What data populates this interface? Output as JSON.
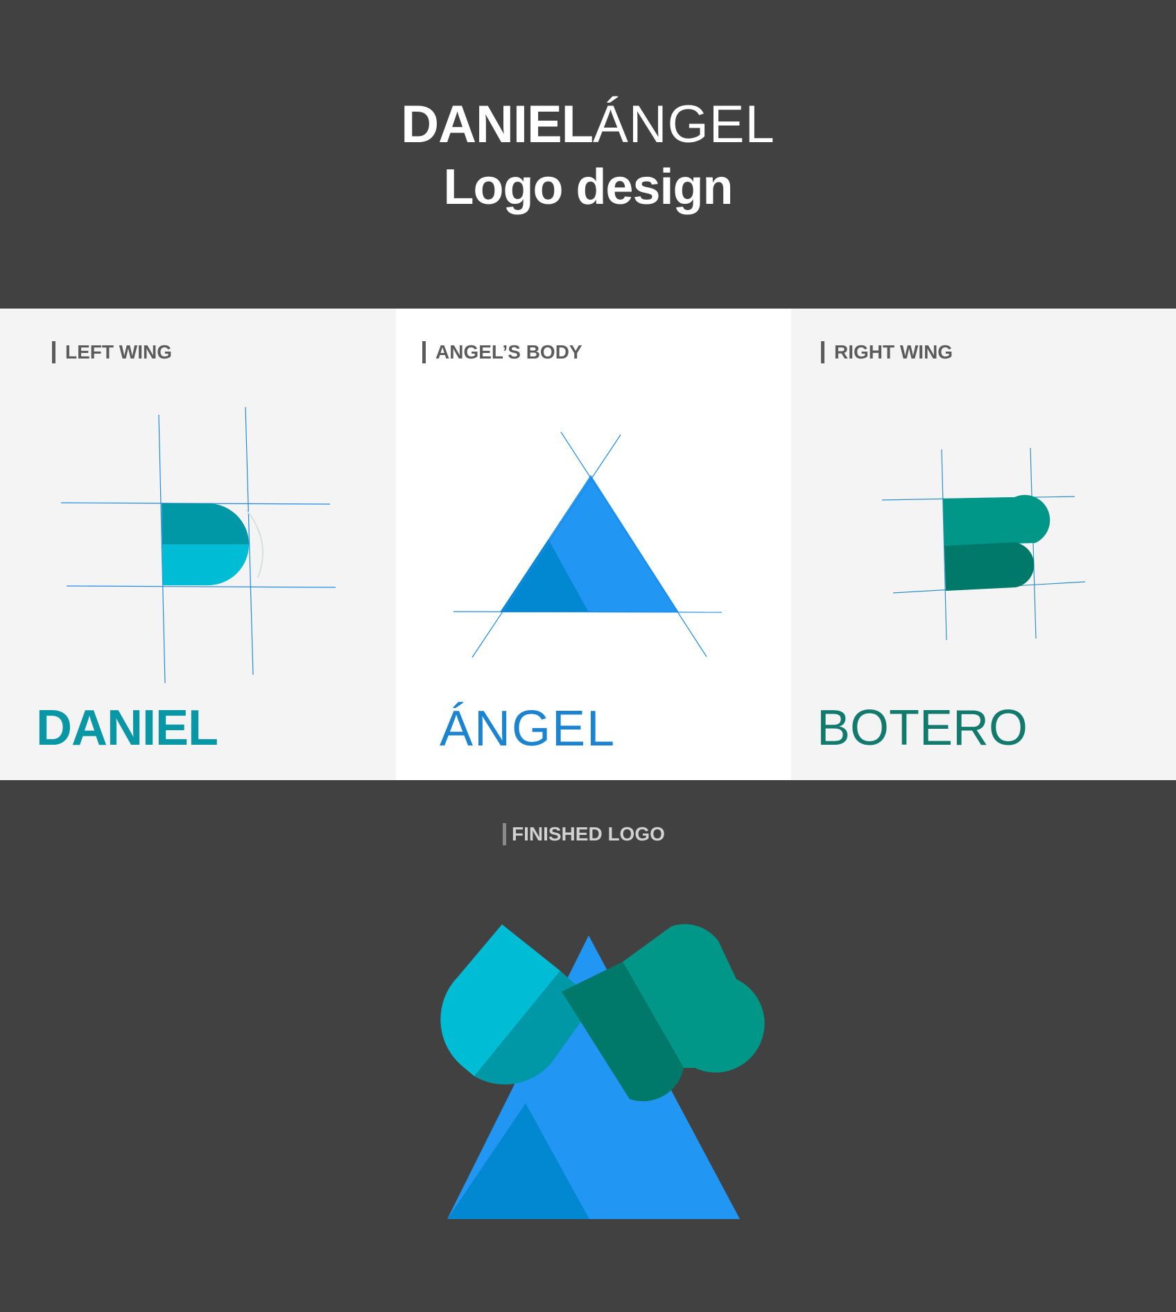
{
  "header": {
    "title_bold": "DANIEL",
    "title_light": "ÁNGEL",
    "subtitle": "Logo design"
  },
  "sections": {
    "left_wing": {
      "label": "LEFT WING",
      "wordmark": "DANIEL"
    },
    "angels_body": {
      "label": "ANGEL’S BODY",
      "wordmark": "ÁNGEL"
    },
    "right_wing": {
      "label": "RIGHT WING",
      "wordmark": "BOTERO"
    }
  },
  "finished": {
    "label": "FINISHED LOGO"
  },
  "colors": {
    "background_dark": "#414141",
    "panel_light": "#f4f4f4",
    "panel_white": "#ffffff",
    "cyan_light": "#00bcd4",
    "cyan_dark": "#0097a7",
    "blue_light": "#2196f3",
    "blue_dark": "#0288d1",
    "teal_light": "#009688",
    "teal_dark": "#00796b",
    "guide_line": "#1e88e5"
  }
}
